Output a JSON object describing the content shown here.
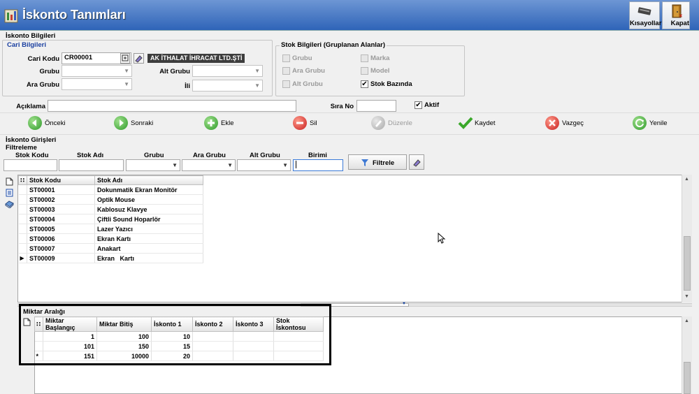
{
  "window": {
    "title": "İskonto Tanımları"
  },
  "toolbar": {
    "shortcuts_label": "Kısayollar",
    "close_label": "Kapat"
  },
  "header": {
    "section_title": "İskonto Bilgileri",
    "cari": {
      "title": "Cari Bilgileri",
      "cari_kodu_label": "Cari Kodu",
      "cari_kodu_value": "CR00001",
      "company_name": "AK İTHALAT İHRACAT LTD.ŞTİ",
      "grubu_label": "Grubu",
      "ara_grubu_label": "Ara Grubu",
      "alt_grubu_label": "Alt Grubu",
      "il_label": "İli"
    },
    "stok": {
      "title": "Stok Bilgileri (Gruplanan Alanlar)",
      "options": [
        {
          "label": "Grubu",
          "checked": false,
          "enabled": false
        },
        {
          "label": "Marka",
          "checked": false,
          "enabled": false
        },
        {
          "label": "Ara Grubu",
          "checked": false,
          "enabled": false
        },
        {
          "label": "Model",
          "checked": false,
          "enabled": false
        },
        {
          "label": "Alt Grubu",
          "checked": false,
          "enabled": false
        },
        {
          "label": "Stok Bazında",
          "checked": true,
          "enabled": true
        }
      ]
    },
    "aciklama_label": "Açıklama",
    "aciklama_value": "",
    "sira_no_label": "Sıra No",
    "sira_no_value": "",
    "aktif_label": "Aktif",
    "aktif_checked": true
  },
  "nav": {
    "prev": "Önceki",
    "next": "Sonraki",
    "add": "Ekle",
    "delete": "Sil",
    "edit": "Düzenle",
    "save": "Kaydet",
    "cancel": "Vazgeç",
    "refresh": "Yenile"
  },
  "entries": {
    "title": "İskonto Girişleri",
    "filter_title": "Filtreleme",
    "filters": {
      "stok_kodu": "Stok Kodu",
      "stok_adi": "Stok Adı",
      "grubu": "Grubu",
      "ara_grubu": "Ara Grubu",
      "alt_grubu": "Alt Grubu",
      "birimi": "Birimi"
    },
    "filter_button": "Filtrele",
    "grid": {
      "columns": [
        "Stok Kodu",
        "Stok Adı"
      ],
      "rows": [
        [
          "ST00001",
          "Dokunmatik Ekran Monitör"
        ],
        [
          "ST00002",
          "Optik Mouse"
        ],
        [
          "ST00003",
          "Kablosuz Klavye"
        ],
        [
          "ST00004",
          "Çiftli Sound Hoparlör"
        ],
        [
          "ST00005",
          "Lazer Yazıcı"
        ],
        [
          "ST00006",
          "Ekran Kartı"
        ],
        [
          "ST00007",
          "Anakart"
        ],
        [
          "ST00009",
          "Ekran   Kartı"
        ]
      ],
      "current_row_marker": "▶"
    }
  },
  "range": {
    "title": "Miktar Aralığı",
    "columns": [
      "Miktar Başlangıç",
      "Miktar Bitiş",
      "İskonto 1",
      "İskonto 2",
      "İskonto 3",
      "Stok İskontosu"
    ],
    "rows": [
      [
        "1",
        "100",
        "10",
        "",
        "",
        ""
      ],
      [
        "101",
        "150",
        "15",
        "",
        "",
        ""
      ],
      [
        "151",
        "10000",
        "20",
        "",
        "",
        ""
      ]
    ],
    "new_row_marker": "*"
  },
  "colors": {
    "title_bar": "#2f64b8",
    "section_blue": "#1a3fa0",
    "highlight_border": "#000000"
  }
}
